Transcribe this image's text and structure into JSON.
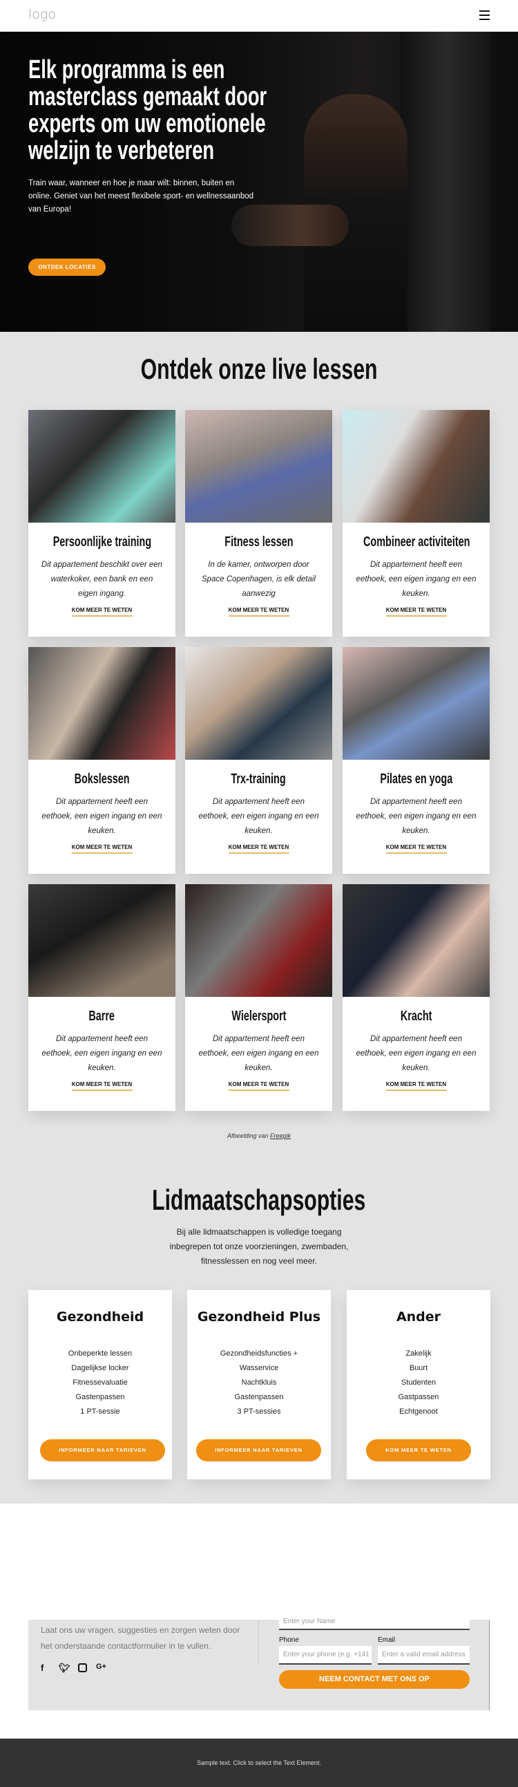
{
  "header": {
    "logo": "logo",
    "menu_icon": "hamburger-icon"
  },
  "hero": {
    "title_lines": [
      "Elk programma is een",
      "masterclass gemaakt door",
      "experts om uw emotionele",
      "welzijn te verbeteren"
    ],
    "text": "Train waar, wanneer en hoe je maar wilt: binnen, buiten en online. Geniet van het meest flexibele sport- en wellnessaanbod van Europa!",
    "button": "ONTDEK LOCATIES"
  },
  "classes": {
    "title": "Ontdek onze live lessen",
    "link_label": "KOM MEER TE WETEN",
    "items": [
      {
        "title": "Persoonlijke training",
        "text": "Dit appartement beschikt over een waterkoker, een bank en een eigen ingang."
      },
      {
        "title": "Fitness lessen",
        "text": "In de kamer, ontworpen door Space Copenhagen, is elk detail aanwezig"
      },
      {
        "title": "Combineer activiteiten",
        "text": "Dit appartement heeft een eethoek, een eigen ingang en een keuken."
      },
      {
        "title": "Bokslessen",
        "text": "Dit appartement heeft een eethoek, een eigen ingang en een keuken."
      },
      {
        "title": "Trx-training",
        "text": "Dit appartement heeft een eethoek, een eigen ingang en een keuken."
      },
      {
        "title": "Pilates en yoga",
        "text": "Dit appartement heeft een eethoek, een eigen ingang en een keuken."
      },
      {
        "title": "Barre",
        "text": "Dit appartement heeft een eethoek, een eigen ingang en een keuken."
      },
      {
        "title": "Wielersport",
        "text": "Dit appartement heeft een eethoek, een eigen ingang en een keuken."
      },
      {
        "title": "Kracht",
        "text": "Dit appartement heeft een eethoek, een eigen ingang en een keuken."
      }
    ],
    "credit_prefix": "Afbeelding van",
    "credit_link": "Freepik"
  },
  "membership": {
    "title": "Lidmaatschapsopties",
    "subtitle": "Bij alle lidmaatschappen is volledige toegang inbegrepen tot onze voorzieningen, zwembaden, fitnesslessen en nog veel meer.",
    "plans": [
      {
        "name": "Gezondheid",
        "features": [
          "Onbeperkte lessen",
          "Dagelijkse locker",
          "Fitnessevaluatie",
          "Gastenpassen",
          "1 PT-sessie"
        ],
        "button": "INFORMEER NAAR TARIEVEN"
      },
      {
        "name": "Gezondheid Plus",
        "features": [
          "Gezondheidsfuncties +",
          "Wasservice",
          "Nachtkluis",
          "Gastenpassen",
          "3 PT-sessies"
        ],
        "button": "INFORMEER NAAR TARIEVEN"
      },
      {
        "name": "Ander",
        "features": [
          "Zakelijk",
          "Buurt",
          "Studenten",
          "Gastpassen",
          "Echtgenoot"
        ],
        "button": "KOM MEER TE WETEN"
      }
    ]
  },
  "contact": {
    "text": "Laat ons uw vragen, suggesties en zorgen weten door het onderstaande contactformulier in te vullen.",
    "social": [
      "facebook-icon",
      "twitter-icon",
      "instagram-icon",
      "google-plus-icon"
    ],
    "name_placeholder": "Enter your Name",
    "phone_label": "Phone",
    "phone_placeholder": "Enter your phone (e.g. +141",
    "email_label": "Email",
    "email_placeholder": "Enter a valid email address",
    "submit": "NEEM CONTACT MET ONS OP"
  },
  "footer": {
    "text": "Sample text. Click to select the Text Element."
  },
  "colors": {
    "accent": "#ef8f13",
    "section_bg": "#e3e3e3",
    "footer_bg": "#333333"
  }
}
